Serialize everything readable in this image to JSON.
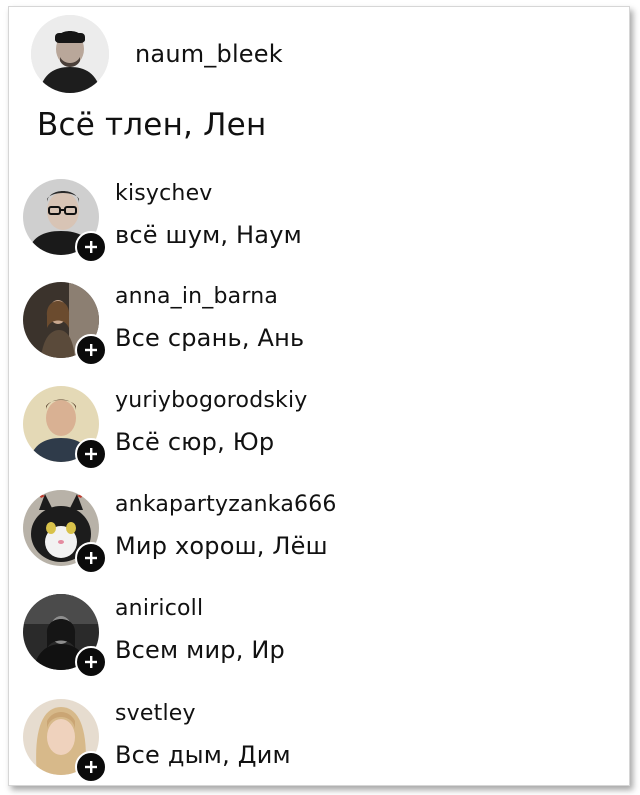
{
  "post": {
    "author": "naum_bleek",
    "text": "Всё тлен, Лен"
  },
  "replies": [
    {
      "username": "kisychev",
      "text": "всё шум, Наум"
    },
    {
      "username": "anna_in_barna",
      "text": "Все срань, Ань"
    },
    {
      "username": "yuriybogorodskiy",
      "text": "Всё сюр, Юр"
    },
    {
      "username": "ankapartyzanka666",
      "text": "Мир хорош, Лёш"
    },
    {
      "username": "aniricoll",
      "text": "Всем мир, Ир"
    },
    {
      "username": "svetley",
      "text": "Все дым, Дим"
    }
  ],
  "icons": {
    "follow": "plus-icon"
  },
  "colors": {
    "badge": "#0b0b0b",
    "text": "#111111"
  }
}
